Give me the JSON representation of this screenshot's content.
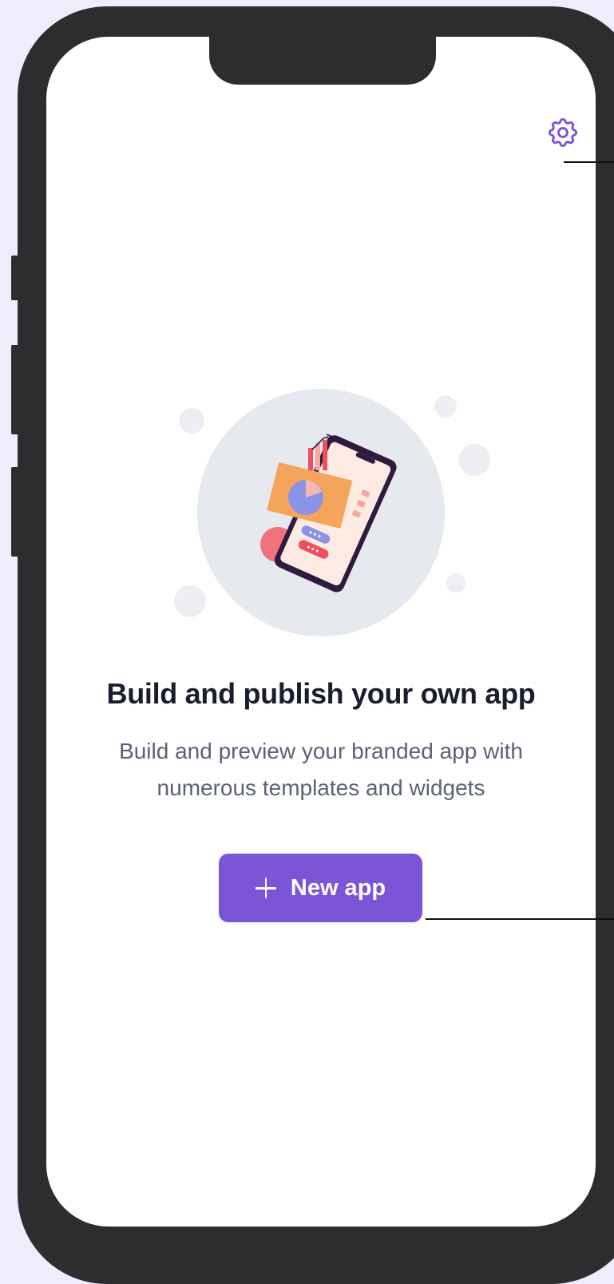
{
  "header": {
    "settings_icon": "gear-icon"
  },
  "empty_state": {
    "illustration": "phone-analytics-illustration",
    "title": "Build and publish your own app",
    "subtitle_line1": "Build and preview your branded app with",
    "subtitle_line2": "numerous templates and widgets"
  },
  "primary_action": {
    "icon": "plus-icon",
    "label": "New app"
  },
  "colors": {
    "accent": "#7B55D6",
    "background": "#EFECFB",
    "frame": "#2D2D2F",
    "title": "#1A1D2E",
    "subtitle": "#5B6274"
  }
}
